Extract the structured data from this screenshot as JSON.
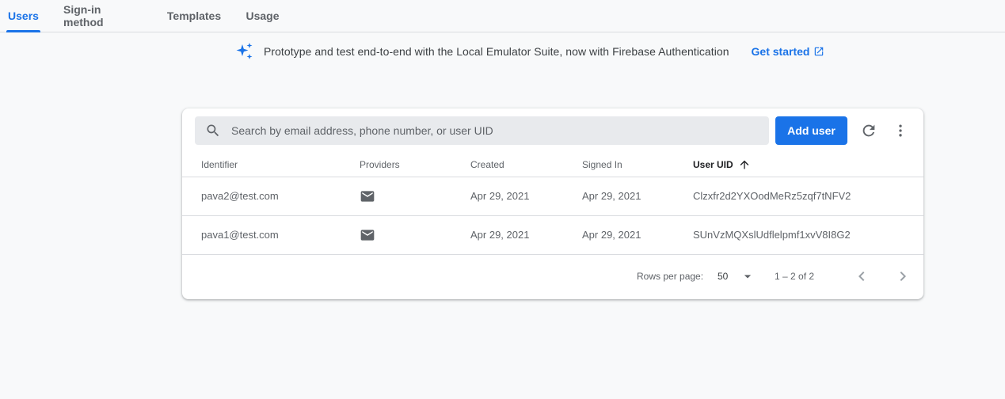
{
  "tabs": [
    {
      "label": "Users",
      "active": true
    },
    {
      "label": "Sign-in method",
      "active": false
    },
    {
      "label": "Templates",
      "active": false
    },
    {
      "label": "Usage",
      "active": false
    }
  ],
  "banner": {
    "icon": "sparkle-icon",
    "message": "Prototype and test end-to-end with the Local Emulator Suite, now with Firebase Authentication",
    "cta_label": "Get started",
    "cta_icon": "open-in-new-icon"
  },
  "toolbar": {
    "search_placeholder": "Search by email address, phone number, or user UID",
    "search_value": "",
    "add_user_label": "Add user",
    "refresh_icon": "refresh-icon",
    "more_icon": "more-vert-icon"
  },
  "table": {
    "columns": [
      "Identifier",
      "Providers",
      "Created",
      "Signed In",
      "User UID"
    ],
    "sorted_column": "User UID",
    "sort_direction": "ascending",
    "rows": [
      {
        "identifier": "pava2@test.com",
        "provider": "email-icon",
        "created": "Apr 29, 2021",
        "signed_in": "Apr 29, 2021",
        "uid": "Clzxfr2d2YXOodMeRz5zqf7tNFV2"
      },
      {
        "identifier": "pava1@test.com",
        "provider": "email-icon",
        "created": "Apr 29, 2021",
        "signed_in": "Apr 29, 2021",
        "uid": "SUnVzMQXslUdflelpmf1xvV8I8G2"
      }
    ]
  },
  "pagination": {
    "rows_per_page_label": "Rows per page:",
    "rows_per_page_value": "50",
    "range": "1 – 2 of 2"
  },
  "colors": {
    "accent": "#1a73e8",
    "background": "#f8f9fa",
    "card": "#ffffff",
    "search_bg": "#e8eaed"
  }
}
